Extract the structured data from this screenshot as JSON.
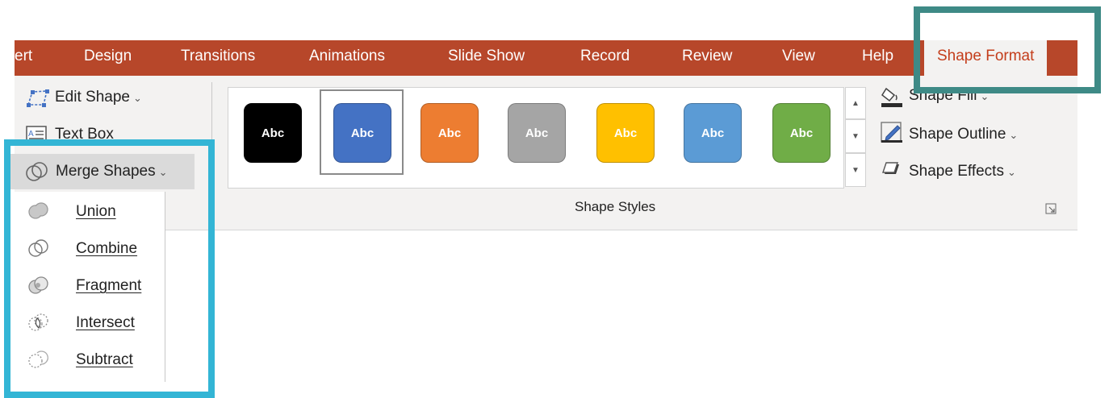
{
  "tabs": [
    "ert",
    "Design",
    "Transitions",
    "Animations",
    "Slide Show",
    "Record",
    "Review",
    "View",
    "Help"
  ],
  "active_tab": "Shape Format",
  "insert_group": {
    "edit_shape": "Edit Shape",
    "text_box": "Text Box",
    "merge_shapes": "Merge Shapes"
  },
  "merge_menu": [
    {
      "label": "Union",
      "icon": "union-icon"
    },
    {
      "label": "Combine",
      "icon": "combine-icon"
    },
    {
      "label": "Fragment",
      "icon": "fragment-icon"
    },
    {
      "label": "Intersect",
      "icon": "intersect-icon"
    },
    {
      "label": "Subtract",
      "icon": "subtract-icon"
    }
  ],
  "shape_styles": {
    "group_label": "Shape Styles",
    "swatch_text": "Abc",
    "swatch_colors": [
      "#000000",
      "#4472c4",
      "#ed7d31",
      "#a5a5a5",
      "#ffc000",
      "#5b9bd5",
      "#70ad47"
    ],
    "selected_index": 1
  },
  "format_commands": {
    "shape_fill": "Shape Fill",
    "shape_outline": "Shape Outline",
    "shape_effects": "Shape Effects"
  },
  "colors": {
    "tab_bar": "#b7472a",
    "active_tab_text": "#c43e1c",
    "ribbon": "#f3f2f1",
    "highlight_blue": "#33b5d5",
    "highlight_teal": "#3e8a86"
  }
}
